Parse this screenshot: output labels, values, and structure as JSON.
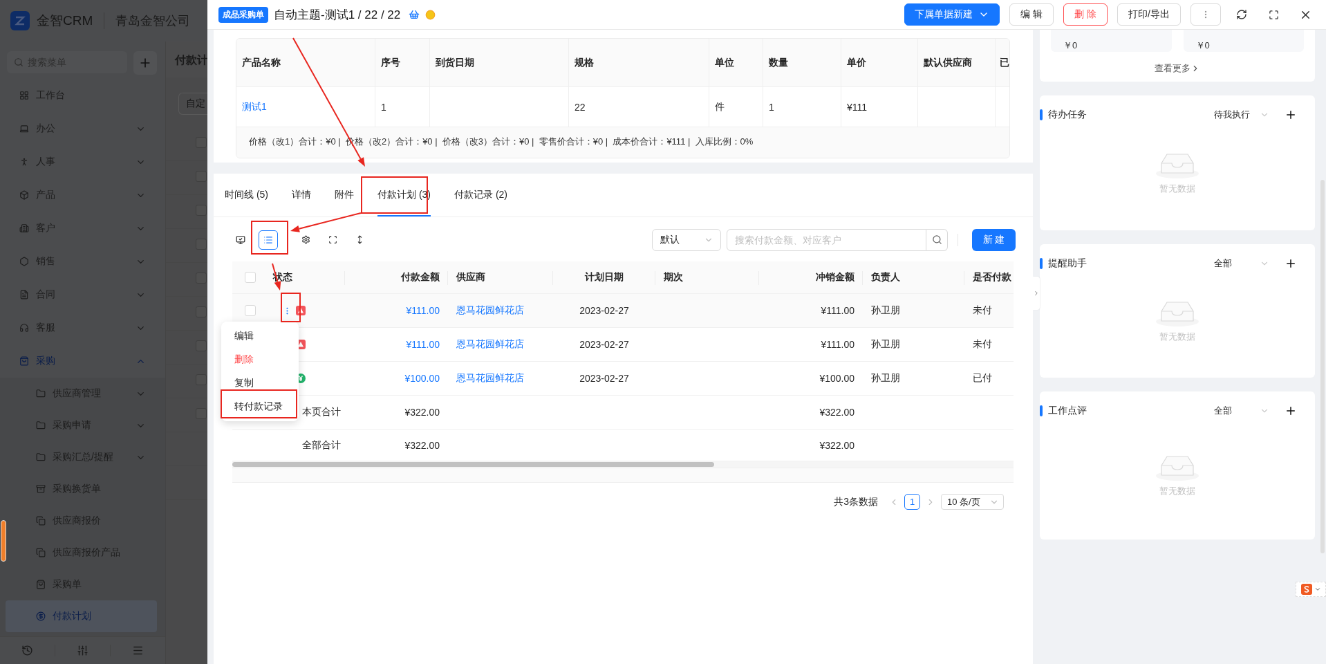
{
  "background_app": {
    "logo_text": "金智CRM",
    "company": "青岛金智公司",
    "search_placeholder": "搜索菜单",
    "page_title": "付款计",
    "filter_placeholder": "自定",
    "rows": [
      {
        "checked": false
      },
      {
        "checked": false
      },
      {
        "checked": false
      },
      {
        "checked": false
      },
      {
        "checked": false
      },
      {
        "checked": false
      },
      {
        "checked": false
      },
      {
        "checked": false
      },
      {
        "checked": false
      }
    ],
    "menu": [
      {
        "label": "工作台",
        "selected": false
      },
      {
        "label": "办公",
        "expanded": false,
        "selected": false
      },
      {
        "label": "人事",
        "expanded": false,
        "selected": false
      },
      {
        "label": "产品",
        "expanded": false,
        "selected": false
      },
      {
        "label": "客户",
        "expanded": false,
        "selected": false
      },
      {
        "label": "销售",
        "expanded": false,
        "selected": false
      },
      {
        "label": "合同",
        "expanded": false,
        "selected": false
      },
      {
        "label": "客服",
        "expanded": false,
        "selected": false
      },
      {
        "label": "采购",
        "expanded": true,
        "selected": true,
        "children": [
          {
            "label": "供应商管理",
            "expanded": false,
            "selected": false
          },
          {
            "label": "采购申请",
            "expanded": false,
            "selected": false
          },
          {
            "label": "采购汇总/提醒",
            "expanded": false,
            "selected": false
          },
          {
            "label": "采购换货单",
            "selected": false
          },
          {
            "label": "供应商报价",
            "selected": false
          },
          {
            "label": "供应商报价产品",
            "selected": false
          },
          {
            "label": "采购单",
            "selected": false
          },
          {
            "label": "付款计划",
            "selected": true
          }
        ]
      }
    ]
  },
  "drawer": {
    "badge": "成品采购单",
    "title": "自动主题-测试1 / 22 / 22",
    "actions": [
      {
        "label": "下属单据新建",
        "kind": "primary"
      },
      {
        "label": "编 辑",
        "kind": "default"
      },
      {
        "label": "删 除",
        "kind": "danger"
      },
      {
        "label": "打印/导出",
        "kind": "default"
      }
    ]
  },
  "products": {
    "columns": [
      "产品名称",
      "序号",
      "到货日期",
      "规格",
      "单位",
      "数量",
      "单价",
      "默认供应商",
      "已"
    ],
    "rows": [
      {
        "cells": [
          "测试1",
          "1",
          null,
          "22",
          "件",
          "1",
          "¥111",
          null,
          null
        ]
      }
    ],
    "summary": "价格（改1）合计：¥0 |  价格（改2）合计：¥0 |  价格（改3）合计：¥0 |  零售价合计：¥0 |  成本价合计：¥111 |  入库比例：0%"
  },
  "tabs": [
    {
      "label": "时间线 (5)",
      "selected": false
    },
    {
      "label": "详情",
      "selected": false
    },
    {
      "label": "附件",
      "selected": false
    },
    {
      "label": "付款计划 (3)",
      "selected": true
    },
    {
      "label": "付款记录 (2)",
      "selected": false
    }
  ],
  "toolbar": {
    "view_modes": [
      {
        "selected": false
      },
      {
        "selected": true
      }
    ],
    "sort": "默认",
    "search_placeholder": "搜索付款金额、对应客户",
    "new_button": "新 建"
  },
  "payment_table": {
    "select_all_checked": false,
    "columns": [
      "状态",
      "付款金额",
      "供应商",
      "计划日期",
      "期次",
      "冲销金额",
      "负责人",
      "是否付款"
    ],
    "rows": [
      {
        "checked": false,
        "menu_open": true,
        "kind": "warning",
        "amount": "¥111.00",
        "supplier": "恩马花园鲜花店",
        "date": "2023-02-27",
        "writeoff": "¥111.00",
        "owner": "孙卫朋",
        "paid": "未付"
      },
      {
        "kind": "warning",
        "amount": "¥111.00",
        "supplier": "恩马花园鲜花店",
        "date": "2023-02-27",
        "writeoff": "¥111.00",
        "owner": "孙卫朋",
        "paid": "未付"
      },
      {
        "kind": "paid",
        "amount": "¥100.00",
        "supplier": "恩马花园鲜花店",
        "date": "2023-02-27",
        "writeoff": "¥100.00",
        "owner": "孙卫朋",
        "paid": "已付"
      }
    ],
    "totals": [
      {
        "label": "本页合计",
        "amount": "¥322.00",
        "writeoff": "¥322.00"
      },
      {
        "label": "全部合计",
        "amount": "¥322.00",
        "writeoff": "¥322.00"
      }
    ],
    "row_menu": [
      {
        "label": "编辑",
        "kind": "normal"
      },
      {
        "label": "删除",
        "kind": "danger"
      },
      {
        "label": "复制",
        "kind": "normal"
      },
      {
        "label": "转付款记录",
        "kind": "normal"
      }
    ]
  },
  "pagination": {
    "total": "共3条数据",
    "pages": [
      {
        "label": "1",
        "selected": true
      }
    ],
    "page_size": "10 条/页"
  },
  "side_panel": {
    "stats": [
      {
        "value": "￥0"
      },
      {
        "value": "￥0"
      }
    ],
    "more_link": "查看更多",
    "cards": [
      {
        "title": "待办任务",
        "filter": "待我执行",
        "empty_text": "暂无数据"
      },
      {
        "title": "提醒助手",
        "filter": "全部",
        "empty_text": "暂无数据"
      },
      {
        "title": "工作点评",
        "filter": "全部",
        "empty_text": "暂无数据"
      }
    ]
  }
}
